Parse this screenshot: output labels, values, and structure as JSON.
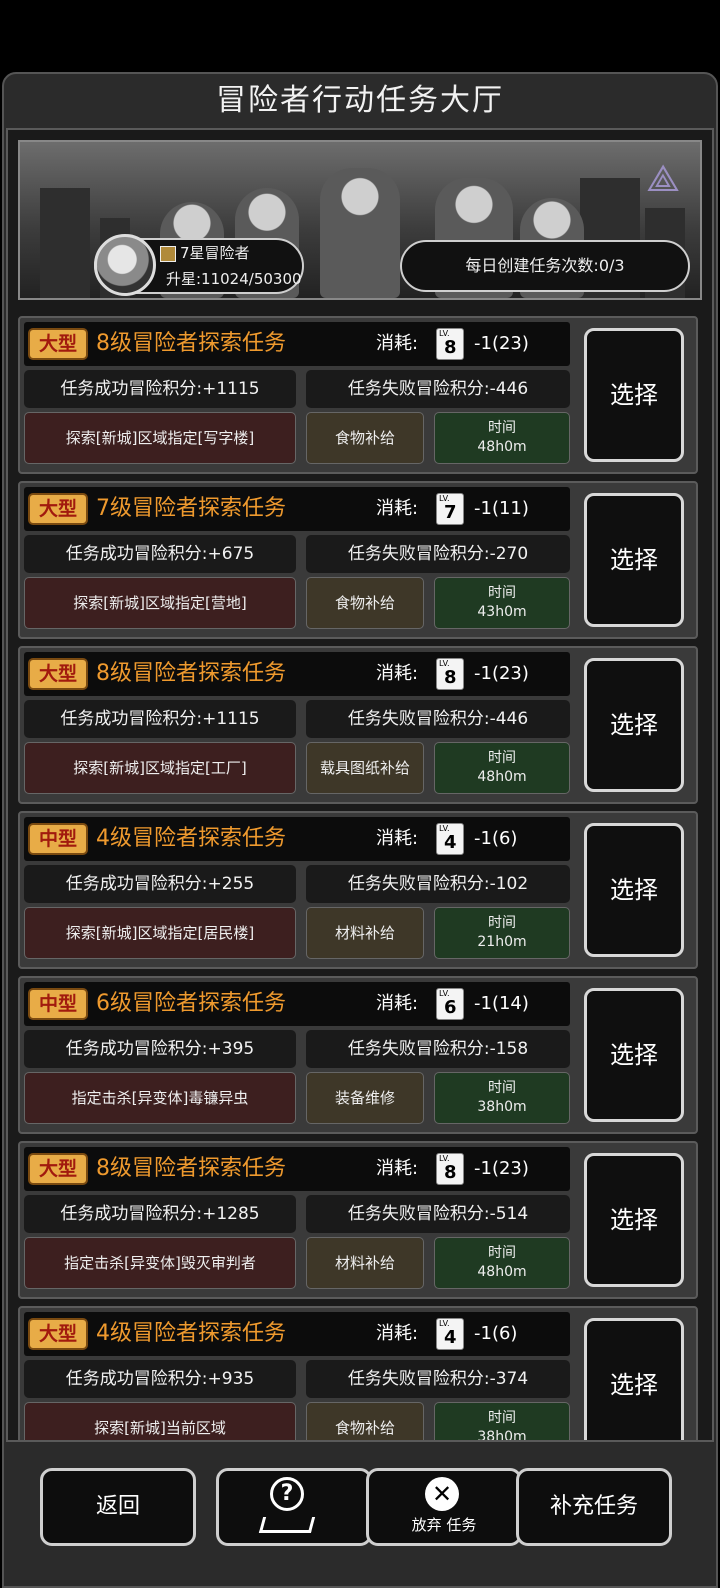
{
  "header": {
    "title": "冒险者行动任务大厅"
  },
  "profile": {
    "rank_title": "7星冒险者",
    "upgrade_progress": "升星:11024/50300",
    "daily_create_count": "每日创建任务次数:0/3"
  },
  "tasks": [
    {
      "size": "大型",
      "name": "8级冒险者探索任务",
      "cost_label": "消耗:",
      "ticket_level": "8",
      "cost_value": "-1(23)",
      "success_score": "任务成功冒险积分:+1115",
      "fail_score": "任务失败冒险积分:-446",
      "location": "探索[新城]区域指定[写字楼]",
      "reward": "食物补给",
      "time_label": "时间",
      "time_value": "48h0m",
      "select_label": "选择"
    },
    {
      "size": "大型",
      "name": "7级冒险者探索任务",
      "cost_label": "消耗:",
      "ticket_level": "7",
      "cost_value": "-1(11)",
      "success_score": "任务成功冒险积分:+675",
      "fail_score": "任务失败冒险积分:-270",
      "location": "探索[新城]区域指定[营地]",
      "reward": "食物补给",
      "time_label": "时间",
      "time_value": "43h0m",
      "select_label": "选择"
    },
    {
      "size": "大型",
      "name": "8级冒险者探索任务",
      "cost_label": "消耗:",
      "ticket_level": "8",
      "cost_value": "-1(23)",
      "success_score": "任务成功冒险积分:+1115",
      "fail_score": "任务失败冒险积分:-446",
      "location": "探索[新城]区域指定[工厂]",
      "reward": "载具图纸补给",
      "time_label": "时间",
      "time_value": "48h0m",
      "select_label": "选择"
    },
    {
      "size": "中型",
      "name": "4级冒险者探索任务",
      "cost_label": "消耗:",
      "ticket_level": "4",
      "cost_value": "-1(6)",
      "success_score": "任务成功冒险积分:+255",
      "fail_score": "任务失败冒险积分:-102",
      "location": "探索[新城]区域指定[居民楼]",
      "reward": "材料补给",
      "time_label": "时间",
      "time_value": "21h0m",
      "select_label": "选择"
    },
    {
      "size": "中型",
      "name": "6级冒险者探索任务",
      "cost_label": "消耗:",
      "ticket_level": "6",
      "cost_value": "-1(14)",
      "success_score": "任务成功冒险积分:+395",
      "fail_score": "任务失败冒险积分:-158",
      "location": "指定击杀[异变体]毒镰异虫",
      "reward": "装备维修",
      "time_label": "时间",
      "time_value": "38h0m",
      "select_label": "选择"
    },
    {
      "size": "大型",
      "name": "8级冒险者探索任务",
      "cost_label": "消耗:",
      "ticket_level": "8",
      "cost_value": "-1(23)",
      "success_score": "任务成功冒险积分:+1285",
      "fail_score": "任务失败冒险积分:-514",
      "location": "指定击杀[异变体]毁灭审判者",
      "reward": "材料补给",
      "time_label": "时间",
      "time_value": "48h0m",
      "select_label": "选择"
    },
    {
      "size": "大型",
      "name": "4级冒险者探索任务",
      "cost_label": "消耗:",
      "ticket_level": "4",
      "cost_value": "-1(6)",
      "success_score": "任务成功冒险积分:+935",
      "fail_score": "任务失败冒险积分:-374",
      "location": "探索[新城]当前区域",
      "reward": "食物补给",
      "time_label": "时间",
      "time_value": "38h0m",
      "select_label": "选择"
    }
  ],
  "bottom": {
    "back_label": "返回",
    "abandon_label": "放弃 任务",
    "refill_label": "补充任务"
  },
  "colors": {
    "task_name": "#ef9a2e",
    "badge": "#e8ac47",
    "location_bg": "#3d1f1f",
    "reward_bg": "#3e3728",
    "time_bg": "#1f3a22"
  }
}
